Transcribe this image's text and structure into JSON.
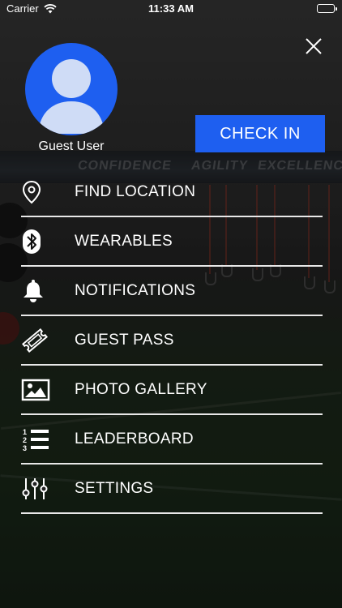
{
  "status_bar": {
    "carrier": "Carrier",
    "time": "11:33 AM"
  },
  "profile": {
    "name": "Guest User"
  },
  "check_in": {
    "label": "CHECK IN"
  },
  "menu": {
    "items": [
      {
        "label": "FIND LOCATION",
        "icon": "location-pin-icon"
      },
      {
        "label": "WEARABLES",
        "icon": "bluetooth-icon"
      },
      {
        "label": "NOTIFICATIONS",
        "icon": "bell-icon"
      },
      {
        "label": "GUEST PASS",
        "icon": "ticket-icon"
      },
      {
        "label": "PHOTO GALLERY",
        "icon": "image-icon"
      },
      {
        "label": "LEADERBOARD",
        "icon": "numbered-list-icon"
      },
      {
        "label": "SETTINGS",
        "icon": "sliders-icon"
      }
    ]
  },
  "background": {
    "wall_words": [
      "CONFIDENCE",
      "AGILITY",
      "EXCELLENCE"
    ]
  },
  "colors": {
    "accent": "#1e5ff0",
    "text": "#ffffff",
    "divider": "#e8e8e8"
  }
}
